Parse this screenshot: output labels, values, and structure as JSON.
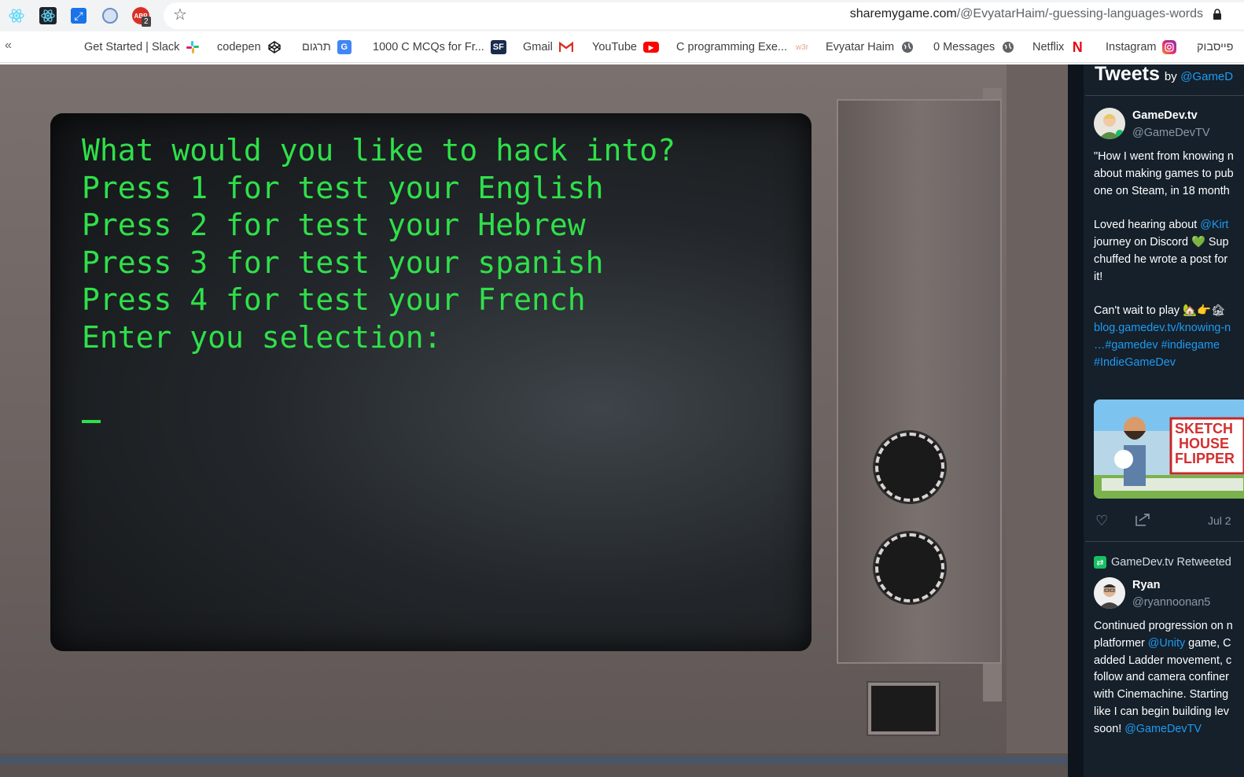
{
  "browser": {
    "url_host": "sharemygame.com",
    "url_path": "/@EvyatarHaim/-guessing-languages-words",
    "extensions": [
      {
        "name": "react-devtools-icon",
        "color": "#61dafb"
      },
      {
        "name": "atom-icon",
        "color": "#66d9ef"
      },
      {
        "name": "resize-arrows-icon",
        "color": "#1a73e8"
      },
      {
        "name": "circle-extension-icon",
        "color": "#6c8ebf"
      },
      {
        "name": "adblock-icon",
        "color": "#d93025",
        "badge": "2"
      }
    ]
  },
  "bookmarks": {
    "items": [
      {
        "label": "Get Started | Slack",
        "icon": "slack-icon"
      },
      {
        "label": "codepen",
        "icon": "codepen-icon"
      },
      {
        "label": "תרגום",
        "icon": "google-translate-icon"
      },
      {
        "label": "1000 C MCQs for Fr...",
        "icon": "sanfoundry-icon"
      },
      {
        "label": "Gmail",
        "icon": "gmail-icon"
      },
      {
        "label": "YouTube",
        "icon": "youtube-icon"
      },
      {
        "label": "C programming Exe...",
        "icon": "w3resource-icon"
      },
      {
        "label": "Evyatar Haim",
        "icon": "globe-icon"
      },
      {
        "label": "0 Messages",
        "icon": "globe-icon"
      },
      {
        "label": "Netflix",
        "icon": "netflix-icon"
      },
      {
        "label": "Instagram",
        "icon": "instagram-icon"
      },
      {
        "label": "פייסבוק",
        "icon": "facebook-icon"
      }
    ]
  },
  "game": {
    "lines": [
      "What would you like to hack into?",
      "Press 1 for test your English",
      "Press 2 for test your Hebrew",
      "Press 3 for test your spanish",
      "Press 4 for test your French",
      "Enter you selection:"
    ],
    "cursor": "_",
    "text_color": "#2fe04a"
  },
  "twitter": {
    "title": "Tweets",
    "by": "by",
    "by_handle": "@GameD",
    "tweet1": {
      "name": "GameDev.tv",
      "handle": "@GameDevTV",
      "text_lines": [
        "\"How I went from knowing n",
        "about making games to pub",
        "one on Steam, in 18 month"
      ],
      "para2_prefix": "Loved hearing about ",
      "para2_mention": "@Kirt",
      "para2_lines": [
        "journey on Discord 💚 Sup",
        "chuffed he wrote a post for",
        "it!"
      ],
      "para3": "Can't wait to play 🏡👉🏚",
      "link1": "blog.gamedev.tv/knowing-n",
      "link2": "…#gamedev #indiegame",
      "link3": "#IndieGameDev",
      "media_title_lines": [
        "SKETCH",
        "HOUSE",
        "FLIPPER"
      ],
      "date": "Jul 2"
    },
    "retweet_label": "GameDev.tv Retweeted",
    "tweet2": {
      "name": "Ryan",
      "handle": "@ryannoonan5",
      "line1": "Continued progression on n",
      "line2_prefix": "platformer ",
      "line2_mention": "@Unity",
      "line2_suffix": " game, C",
      "lines": [
        "added Ladder movement, c",
        "follow and camera confiner",
        "with Cinemachine. Starting",
        "like I can begin building lev"
      ],
      "last_prefix": "soon! ",
      "last_mention": "@GameDevTV"
    }
  }
}
